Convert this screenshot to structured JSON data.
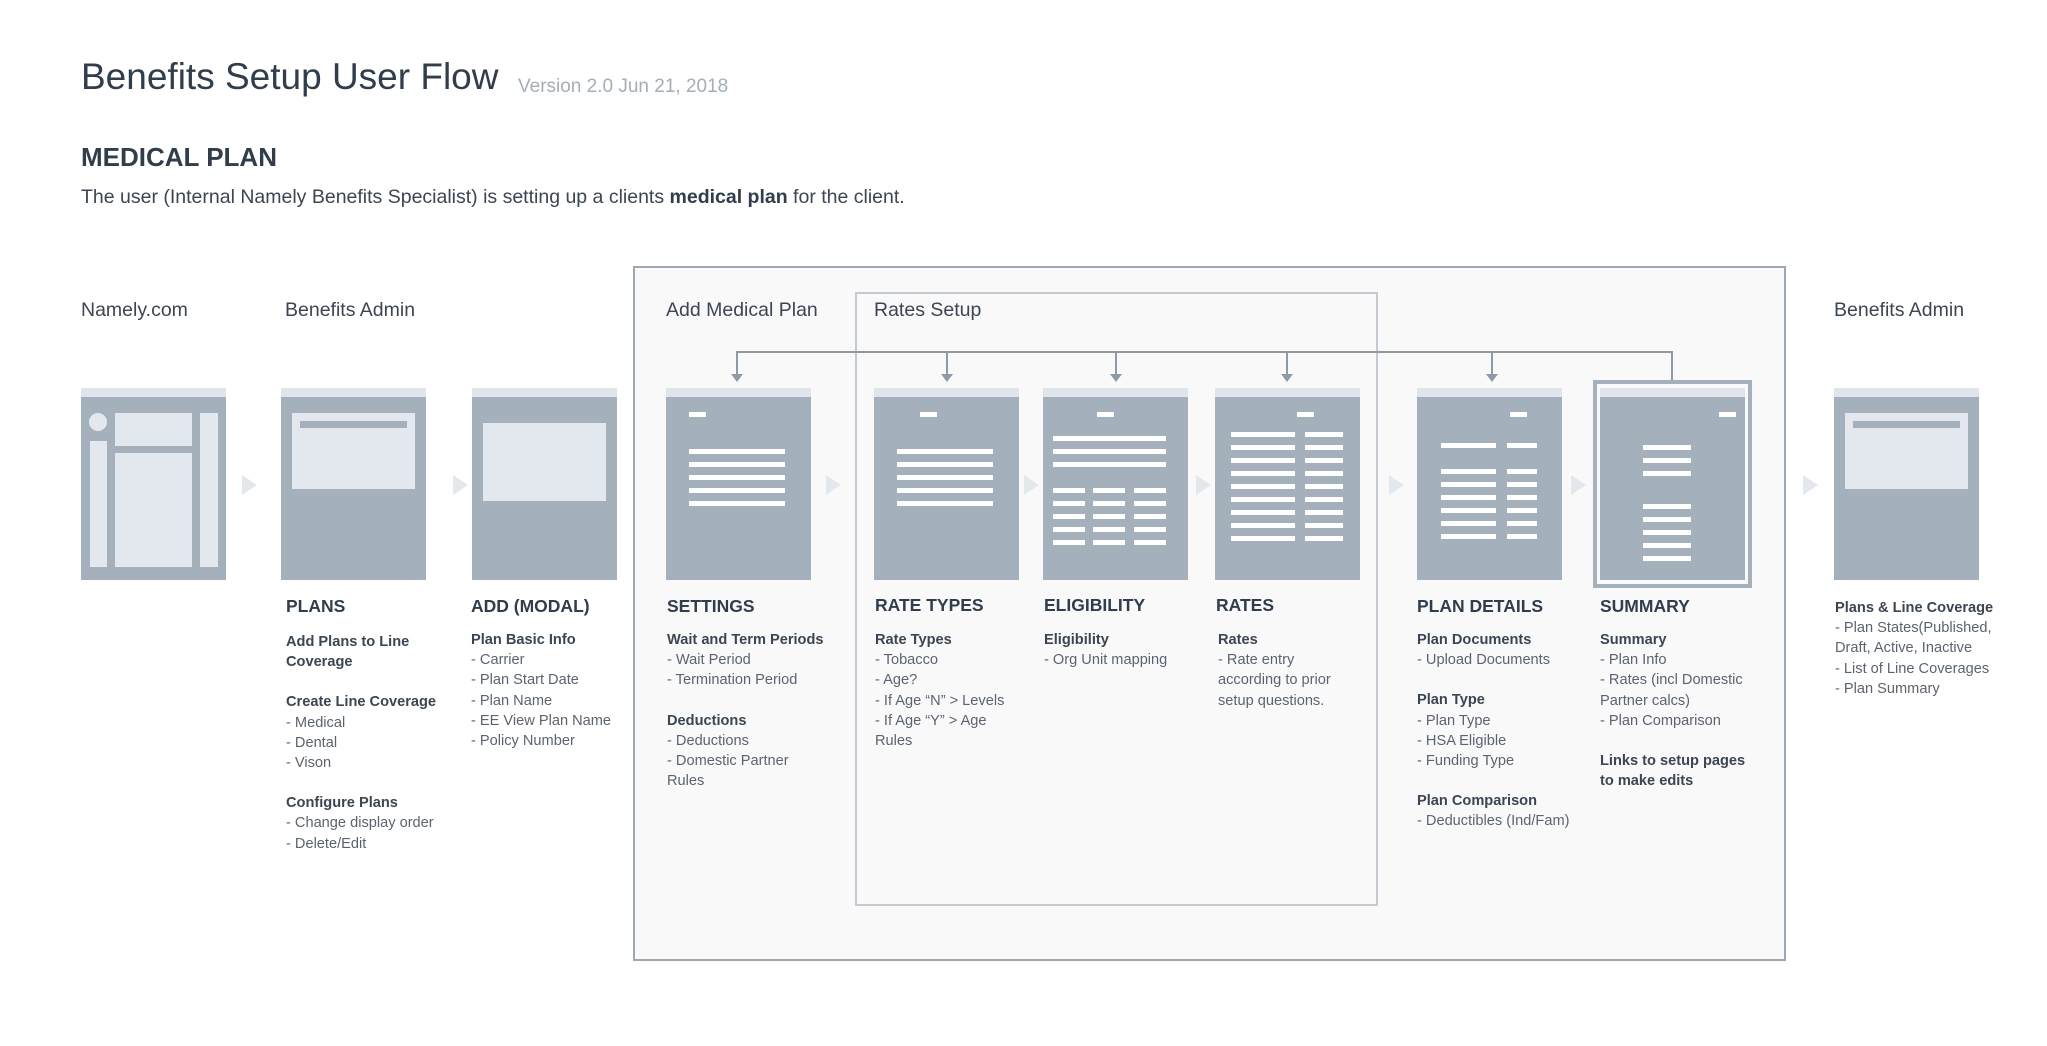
{
  "header": {
    "title": "Benefits Setup User Flow",
    "version": "Version 2.0 Jun 21, 2018",
    "section_title": "MEDICAL PLAN",
    "desc_before": "The user (Internal Namely Benefits Specialist) is setting up a clients ",
    "desc_bold": "medical plan",
    "desc_after": " for the client."
  },
  "columns": {
    "namely": "Namely.com",
    "benefits_admin": "Benefits Admin",
    "add_medical_plan": "Add Medical Plan",
    "rates_setup": "Rates Setup",
    "benefits_admin_end": "Benefits Admin"
  },
  "screens": {
    "plans": {
      "label": "PLANS",
      "details": [
        {
          "text": "Add Plans to Line",
          "bold": true
        },
        {
          "text": "Coverage",
          "bold": true
        },
        {
          "gap": true
        },
        {
          "text": "Create Line Coverage",
          "bold": true
        },
        {
          "text": "- Medical"
        },
        {
          "text": "- Dental"
        },
        {
          "text": "- Vison"
        },
        {
          "gap": true
        },
        {
          "text": "Configure Plans",
          "bold": true
        },
        {
          "text": "- Change display order"
        },
        {
          "text": "- Delete/Edit"
        }
      ]
    },
    "add_modal": {
      "label": "ADD (MODAL)",
      "details": [
        {
          "text": "Plan Basic Info",
          "bold": true
        },
        {
          "text": "- Carrier"
        },
        {
          "text": "- Plan Start Date"
        },
        {
          "text": "- Plan Name"
        },
        {
          "text": "- EE View Plan Name"
        },
        {
          "text": "- Policy Number"
        }
      ]
    },
    "settings": {
      "label": "SETTINGS",
      "details": [
        {
          "text": "Wait and Term Periods",
          "bold": true
        },
        {
          "text": "- Wait Period"
        },
        {
          "text": "- Termination Period"
        },
        {
          "gap": true
        },
        {
          "text": "Deductions",
          "bold": true
        },
        {
          "text": "- Deductions"
        },
        {
          "text": "- Domestic Partner"
        },
        {
          "text": "  Rules"
        }
      ]
    },
    "rate_types": {
      "label": "RATE TYPES",
      "details": [
        {
          "text": "Rate Types",
          "bold": true
        },
        {
          "text": "- Tobacco"
        },
        {
          "text": "- Age?"
        },
        {
          "text": "- If Age “N” >  Levels"
        },
        {
          "text": "- If Age “Y” > Age"
        },
        {
          "text": "  Rules"
        }
      ]
    },
    "eligibility": {
      "label": "ELIGIBILITY",
      "details": [
        {
          "text": "Eligibility",
          "bold": true
        },
        {
          "text": "- Org Unit mapping"
        }
      ]
    },
    "rates": {
      "label": "RATES",
      "details": [
        {
          "text": "Rates",
          "bold": true
        },
        {
          "text": "- Rate entry"
        },
        {
          "text": "  according to prior"
        },
        {
          "text": "  setup questions."
        }
      ]
    },
    "plan_details": {
      "label": "PLAN DETAILS",
      "details": [
        {
          "text": "Plan Documents",
          "bold": true
        },
        {
          "text": "- Upload Documents"
        },
        {
          "gap": true
        },
        {
          "text": "Plan Type",
          "bold": true
        },
        {
          "text": "- Plan Type"
        },
        {
          "text": "- HSA Eligible"
        },
        {
          "text": "- Funding Type"
        },
        {
          "gap": true
        },
        {
          "text": "Plan Comparison",
          "bold": true
        },
        {
          "text": "- Deductibles (Ind/Fam)"
        }
      ]
    },
    "summary": {
      "label": "SUMMARY",
      "details": [
        {
          "text": "Summary",
          "bold": true
        },
        {
          "text": "- Plan Info"
        },
        {
          "text": "- Rates (incl Domestic"
        },
        {
          "text": "  Partner calcs)"
        },
        {
          "text": "- Plan Comparison"
        },
        {
          "gap": true
        },
        {
          "text": "Links to setup pages",
          "bold": true
        },
        {
          "text": "to make edits",
          "bold": true
        }
      ]
    },
    "benefits_admin_end": {
      "label": "",
      "details": [
        {
          "text": "Plans & Line Coverage",
          "bold": true
        },
        {
          "text": "- Plan States(Published,"
        },
        {
          "text": "  Draft, Active, Inactive"
        },
        {
          "text": "- List of Line Coverages"
        },
        {
          "text": "- Plan Summary"
        }
      ]
    }
  },
  "colors": {
    "screen_fill": "#a4b0bb",
    "screen_inner": "#e2e8ee",
    "panel_border": "#9ca8b4",
    "panel_fill": "#f9f9fa",
    "heading_text": "#2f3d4d"
  }
}
